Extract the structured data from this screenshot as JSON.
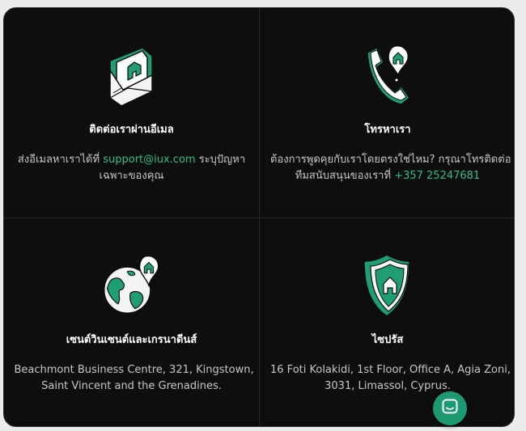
{
  "colors": {
    "accent": "#2fbf8a",
    "icon_green": "#1f9d73",
    "chat_button": "#1d9a72"
  },
  "cards": [
    {
      "icon": "mail-icon",
      "title": "ติดต่อเราผ่านอีเมล",
      "desc_line1_prefix": "ส่งอีเมลหาเราได้ที่ ",
      "desc_line1_link": "support@iux.com",
      "desc_line1_suffix": " ระบุปัญหา",
      "desc_line2": "เฉพาะของคุณ"
    },
    {
      "icon": "phone-icon",
      "title": "โทรหาเรา",
      "desc_line1": "ต้องการพูดคุยกับเราโดยตรงใช่ไหม? กรุณาโทรติดต่อ",
      "desc_line2_prefix": "ทีมสนับสนุนของเราที่ ",
      "desc_line2_link": "+357 25247681"
    },
    {
      "icon": "globe-icon",
      "title": "เซนต์วินเซนต์และเกรนาดีนส์",
      "desc_line1": "Beachmont Business Centre, 321, Kingstown,",
      "desc_line2": "Saint Vincent and the Grenadines."
    },
    {
      "icon": "shield-icon",
      "title": "ไซปรัส",
      "desc_line1": "16 Foti Kolakidi, 1st Floor, Office A, Agia Zoni,",
      "desc_line2": "3031, Limassol, Cyprus."
    }
  ],
  "chat_button": {
    "icon": "chat-icon"
  }
}
